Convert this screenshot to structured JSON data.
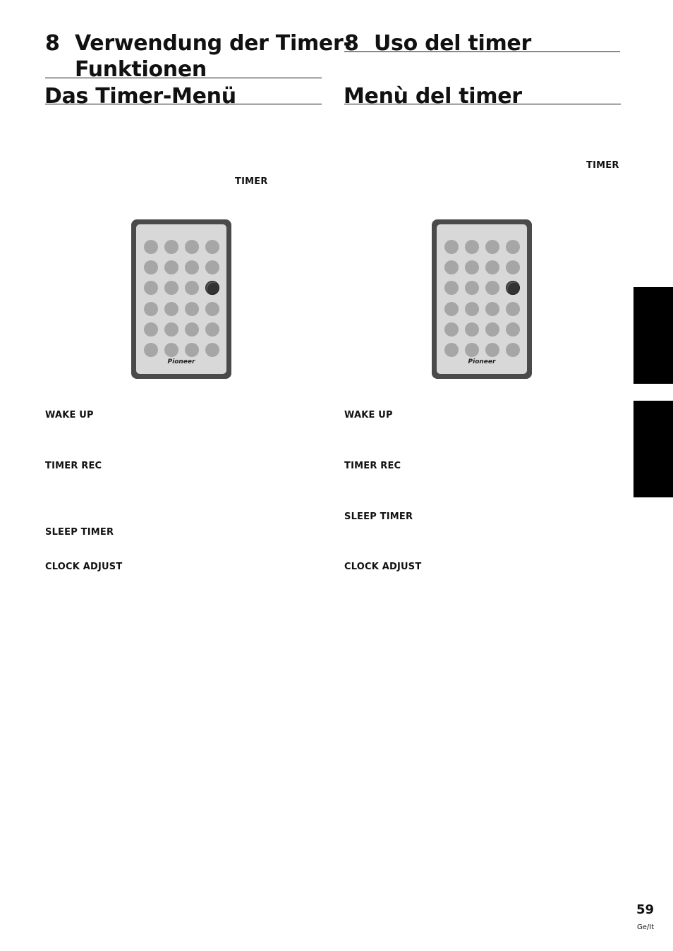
{
  "left": {
    "chapter_number": "8",
    "chapter_title_line1": "Verwendung der Timer-",
    "chapter_title_line2": "Funktionen",
    "section_title": "Das Timer-Menü",
    "button_reference": "TIMER",
    "items": [
      "WAKE UP",
      "TIMER REC",
      "SLEEP TIMER",
      "CLOCK ADJUST"
    ],
    "remote_logo": "Pioneer"
  },
  "right": {
    "chapter_number": "8",
    "chapter_title": "Uso del timer",
    "section_title": "Menù del timer",
    "button_reference": "TIMER",
    "items": [
      "WAKE UP",
      "TIMER REC",
      "SLEEP TIMER",
      "CLOCK ADJUST"
    ],
    "remote_logo": "Pioneer"
  },
  "footer": {
    "page_number": "59",
    "language_code": "Ge/It"
  }
}
